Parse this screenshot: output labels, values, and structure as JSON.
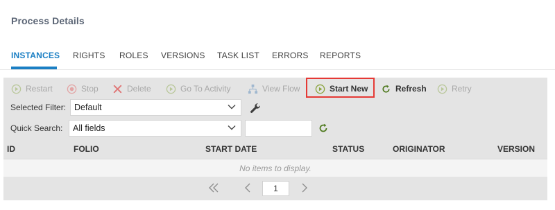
{
  "page": {
    "title": "Process Details"
  },
  "tabs": [
    {
      "label": "INSTANCES",
      "active": true
    },
    {
      "label": "RIGHTS"
    },
    {
      "label": "ROLES"
    },
    {
      "label": "VERSIONS"
    },
    {
      "label": "TASK LIST"
    },
    {
      "label": "ERRORS"
    },
    {
      "label": "REPORTS"
    }
  ],
  "toolbar": {
    "restart": "Restart",
    "stop": "Stop",
    "delete": "Delete",
    "go_to_activity": "Go To Activity",
    "view_flow": "View Flow",
    "start_new": "Start New",
    "refresh": "Refresh",
    "retry": "Retry"
  },
  "filters": {
    "selected_filter_label": "Selected Filter:",
    "selected_filter_value": "Default",
    "quick_search_label": "Quick Search:",
    "quick_search_scope": "All fields",
    "quick_search_text": ""
  },
  "grid": {
    "columns": [
      "ID",
      "FOLIO",
      "START DATE",
      "STATUS",
      "ORIGINATOR",
      "VERSION"
    ],
    "empty_message": "No items to display."
  },
  "pager": {
    "page": "1"
  },
  "colors": {
    "accent": "#1b7fc4",
    "highlight_border": "#e53935",
    "enabled_icon": "#6b8e23",
    "disabled_icon": "#b9c79a",
    "delete_icon": "#d9534f"
  }
}
